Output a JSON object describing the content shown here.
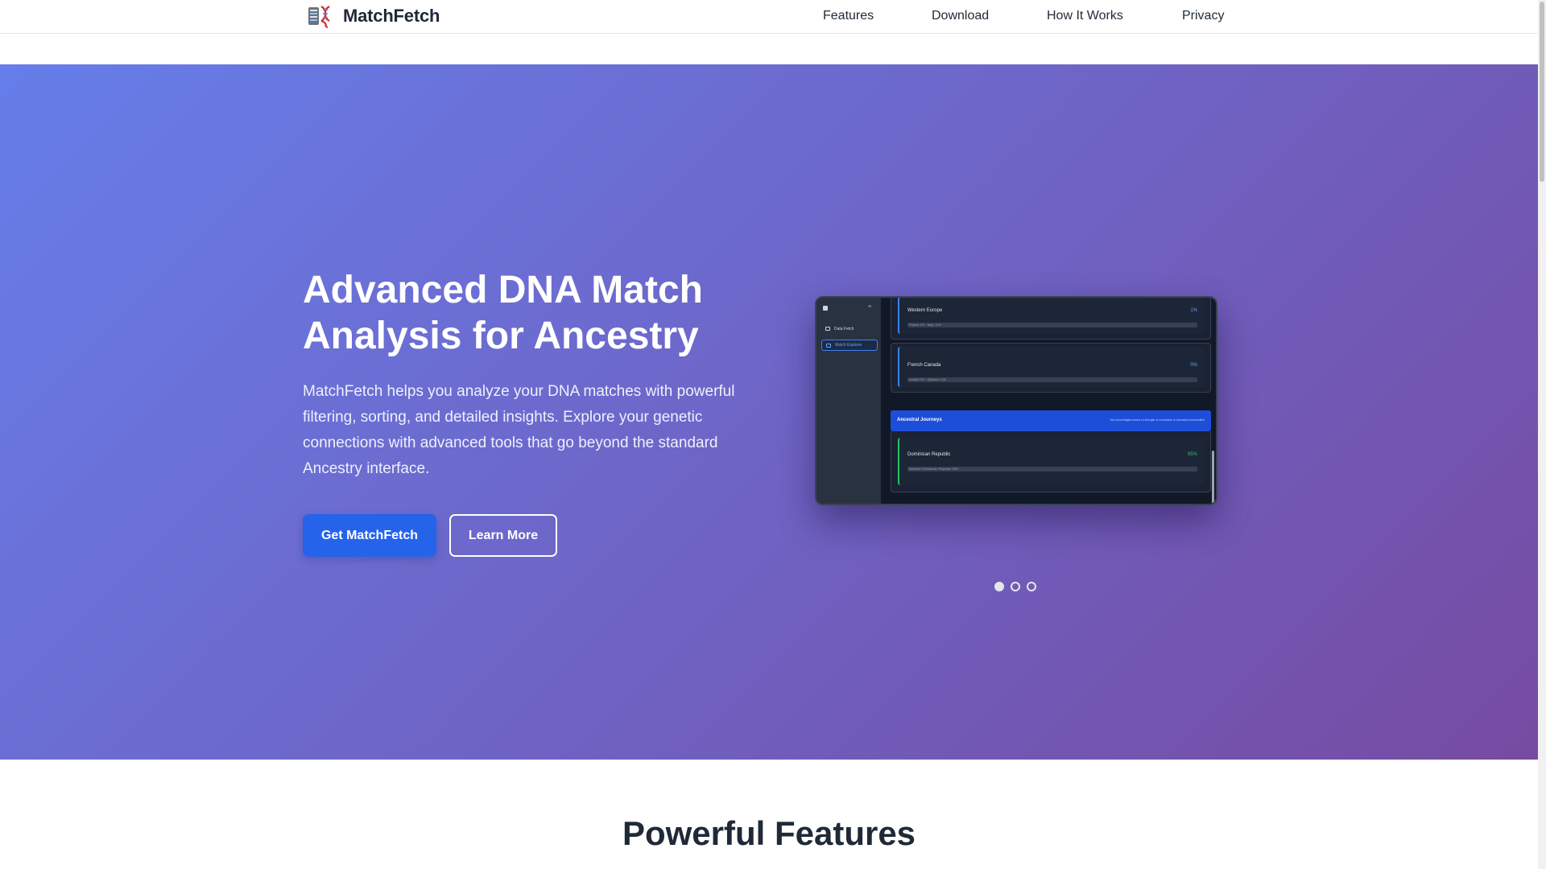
{
  "nav": {
    "brand": "MatchFetch",
    "links": [
      "Features",
      "Download",
      "How It Works",
      "Privacy"
    ]
  },
  "hero": {
    "title": "Advanced DNA Match Analysis for Ancestry",
    "description": "MatchFetch helps you analyze your DNA matches with powerful filtering, sorting, and detailed insights. Explore your genetic connections with advanced tools that go beyond the standard Ancestry interface.",
    "primary_button": "Get MatchFetch",
    "secondary_button": "Learn More"
  },
  "screenshot": {
    "menu_glyph": "≡",
    "sidebar": [
      "Data Fetch",
      "Match Explorer"
    ],
    "regions": [
      {
        "name": "Western Europe",
        "pct": "1%",
        "sub": "France 1% · Italy <1%"
      },
      {
        "name": "French Canada",
        "pct": "0%",
        "sub": "Acadia 0% · Quebec <1%"
      }
    ],
    "journeys_title": "Ancestral Journeys",
    "journeys_note": "Your percentages based on strength of connection to Ancestral communities",
    "journey": {
      "name": "Dominican Republic",
      "pct": "95%",
      "sub": "Northern Dominican Republic 95%"
    }
  },
  "carousel": {
    "slides": 3,
    "active": 1
  },
  "features": {
    "title": "Powerful Features"
  },
  "colors": {
    "primary": "#2563eb",
    "gradient_start": "#667eea",
    "gradient_end": "#764ba2"
  }
}
